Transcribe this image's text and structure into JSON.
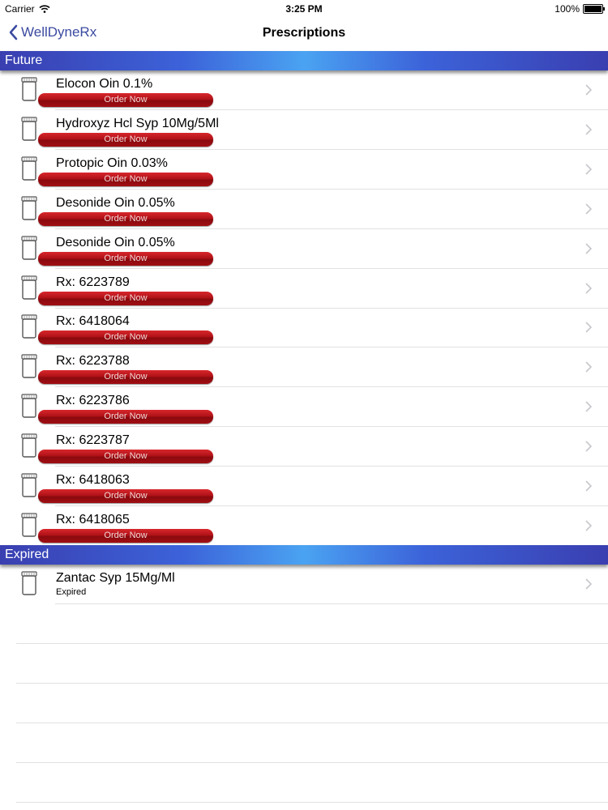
{
  "status_bar": {
    "carrier": "Carrier",
    "time": "3:25 PM",
    "battery": "100%"
  },
  "nav": {
    "back_label": "WellDyneRx",
    "title": "Prescriptions"
  },
  "sections": [
    {
      "title": "Future",
      "rows": [
        {
          "title": "Elocon Oin 0.1%",
          "action": "Order Now"
        },
        {
          "title": "Hydroxyz Hcl Syp 10Mg/5Ml",
          "action": "Order Now"
        },
        {
          "title": "Protopic Oin 0.03%",
          "action": "Order Now"
        },
        {
          "title": "Desonide Oin 0.05%",
          "action": "Order Now"
        },
        {
          "title": "Desonide Oin 0.05%",
          "action": "Order Now"
        },
        {
          "title": "Rx: 6223789",
          "action": "Order Now"
        },
        {
          "title": "Rx: 6418064",
          "action": "Order Now"
        },
        {
          "title": "Rx: 6223788",
          "action": "Order Now"
        },
        {
          "title": "Rx: 6223786",
          "action": "Order Now"
        },
        {
          "title": "Rx: 6223787",
          "action": "Order Now"
        },
        {
          "title": "Rx: 6418063",
          "action": "Order Now"
        },
        {
          "title": "Rx: 6418065",
          "action": "Order Now"
        }
      ]
    },
    {
      "title": "Expired",
      "rows": [
        {
          "title": "Zantac Syp 15Mg/Ml",
          "subtitle": "Expired"
        }
      ]
    }
  ],
  "colors": {
    "accent": "#3b4aa0",
    "order_button": "#b01218"
  }
}
